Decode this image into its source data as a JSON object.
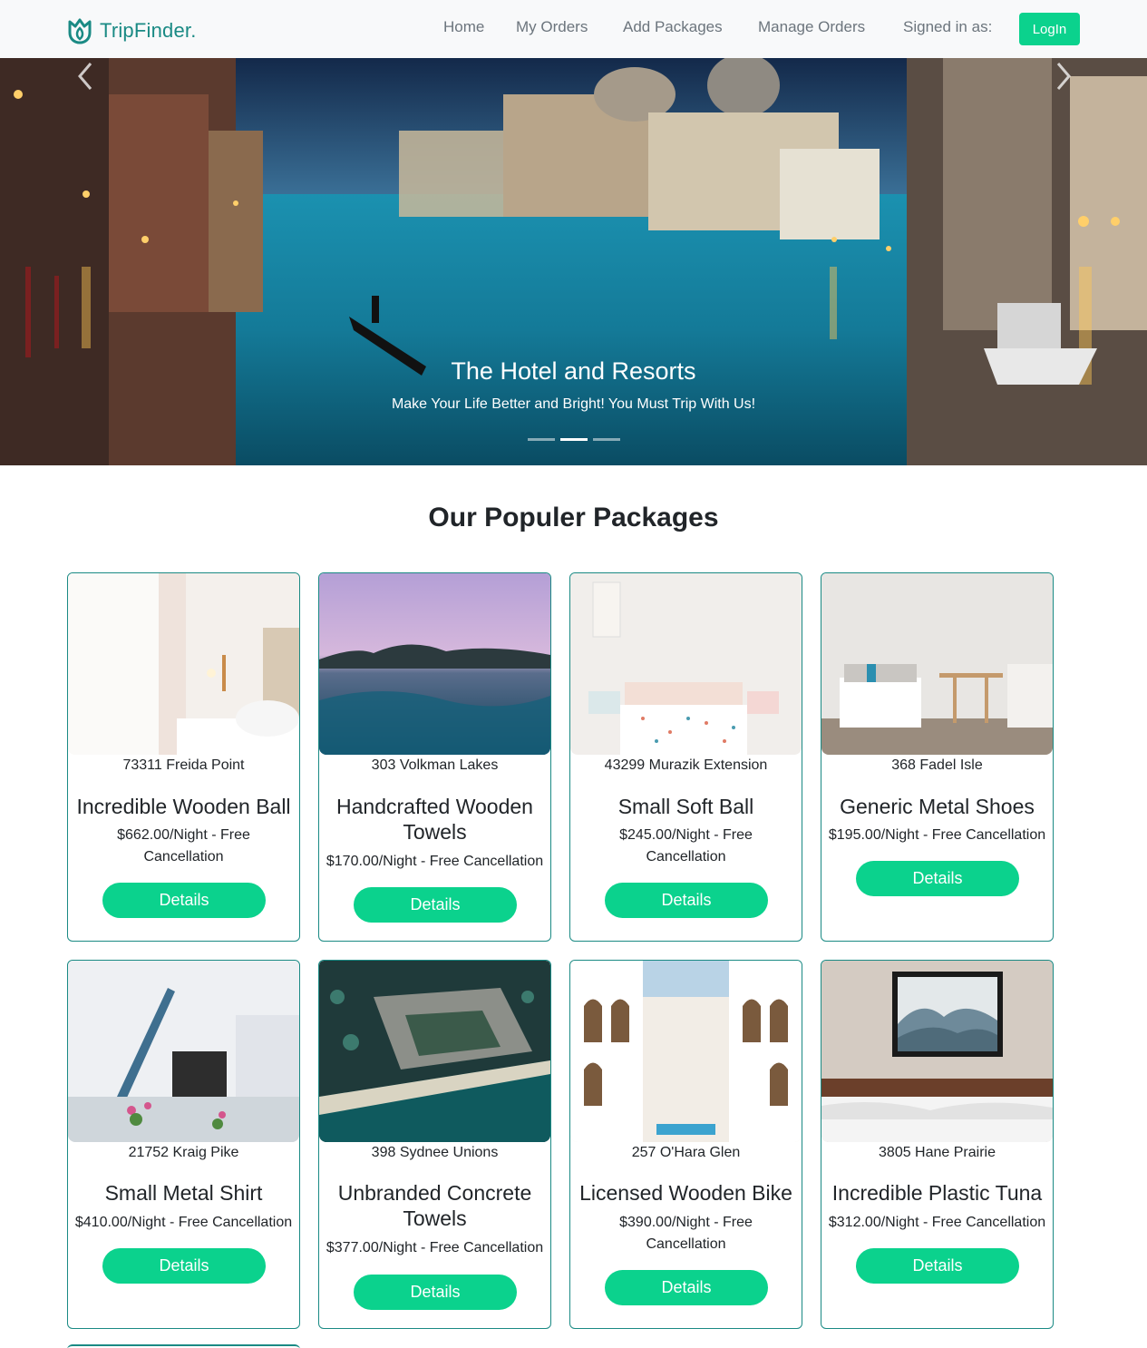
{
  "navbar": {
    "brand": "TripFinder.",
    "links": [
      "Home",
      "My Orders",
      "Add Packages",
      "Manage Orders",
      "Signed in as:"
    ],
    "login_label": "LogIn",
    "brand_color": "#1a8a84",
    "accent_color": "#0bd28d"
  },
  "hero": {
    "title": "The Hotel and Resorts",
    "subtitle": "Make Your Life Better and Bright! You Must Trip With Us!",
    "active_slide": 1,
    "slide_count": 3,
    "prev_icon": "chevron-left-icon",
    "next_icon": "chevron-right-icon"
  },
  "section": {
    "title": "Our Populer Packages"
  },
  "packages": [
    {
      "address": "73311 Freida Point",
      "title": "Incredible Wooden Ball",
      "price": "$662.00/Night - Free Cancellation",
      "button": "Details"
    },
    {
      "address": "303 Volkman Lakes",
      "title": "Handcrafted Wooden Towels",
      "price": "$170.00/Night - Free Cancellation",
      "button": "Details"
    },
    {
      "address": "43299 Murazik Extension",
      "title": "Small Soft Ball",
      "price": "$245.00/Night - Free Cancellation",
      "button": "Details"
    },
    {
      "address": "368 Fadel Isle",
      "title": "Generic Metal Shoes",
      "price": "$195.00/Night - Free Cancellation",
      "button": "Details"
    },
    {
      "address": "21752 Kraig Pike",
      "title": "Small Metal Shirt",
      "price": "$410.00/Night - Free Cancellation",
      "button": "Details"
    },
    {
      "address": "398 Sydnee Unions",
      "title": "Unbranded Concrete Towels",
      "price": "$377.00/Night - Free Cancellation",
      "button": "Details"
    },
    {
      "address": "257 O'Hara Glen",
      "title": "Licensed Wooden Bike",
      "price": "$390.00/Night - Free Cancellation",
      "button": "Details"
    },
    {
      "address": "3805 Hane Prairie",
      "title": "Incredible Plastic Tuna",
      "price": "$312.00/Night - Free Cancellation",
      "button": "Details"
    }
  ]
}
